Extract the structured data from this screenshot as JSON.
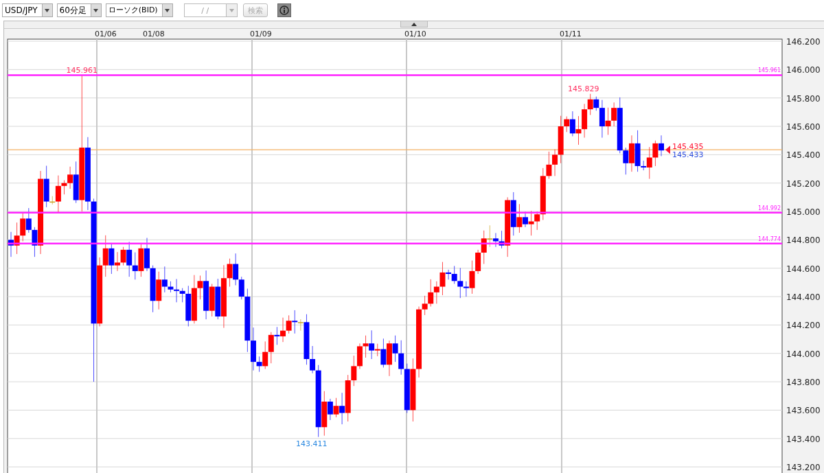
{
  "toolbar": {
    "symbol": {
      "value": "USD/JPY"
    },
    "timeframe": {
      "value": "60分足"
    },
    "chart_type": {
      "value": "ローソク(BID)"
    },
    "date_field": {
      "placeholder": "/ /"
    },
    "search_button": {
      "label": "検索",
      "disabled": true
    }
  },
  "chart": {
    "date_labels": [
      {
        "label": "01/06",
        "gridline": true
      },
      {
        "label": "01/08",
        "gridline": false
      },
      {
        "label": "01/09",
        "gridline": true
      },
      {
        "label": "01/10",
        "gridline": true
      },
      {
        "label": "01/11",
        "gridline": true
      }
    ],
    "price_ticks": [
      "146.200",
      "146.000",
      "145.800",
      "145.600",
      "145.400",
      "145.200",
      "145.000",
      "144.800",
      "144.600",
      "144.400",
      "144.200",
      "144.000",
      "143.800",
      "143.600",
      "143.400",
      "143.200"
    ],
    "horizontal_lines": [
      {
        "label": "145.961"
      },
      {
        "label": "144.992"
      },
      {
        "label": "144.774"
      }
    ],
    "high_label": "145.961",
    "recent_high_label": "145.829",
    "low_label": "143.411",
    "bid": "145.435",
    "ask": "145.433"
  }
}
